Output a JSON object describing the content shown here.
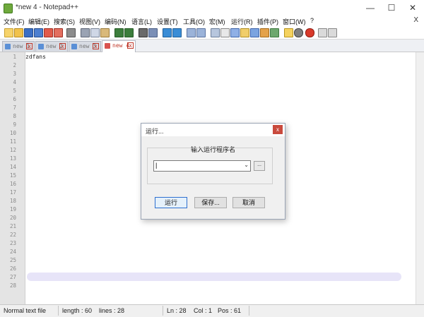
{
  "window": {
    "title": "*new 4 - Notepad++",
    "minimize_glyph": "—",
    "maximize_glyph": "☐",
    "close_glyph": "✕"
  },
  "menubar": {
    "items": [
      "文件(F)",
      "编辑(E)",
      "搜索(S)",
      "视图(V)",
      "编码(N)",
      "语言(L)",
      "设置(T)",
      "工具(O)",
      "宏(M)",
      "运行(R)",
      "插件(P)",
      "窗口(W)",
      "?"
    ],
    "close_glyph": "X"
  },
  "toolbar": {
    "icons": [
      "new-file-icon",
      "open-file-icon",
      "save-icon",
      "save-all-icon",
      "close-icon",
      "close-all-icon",
      "print-icon",
      "cut-icon",
      "copy-icon",
      "paste-icon",
      "undo-icon",
      "redo-icon",
      "find-icon",
      "replace-icon",
      "zoom-in-icon",
      "zoom-out-icon",
      "sync-v-icon",
      "sync-h-icon",
      "word-wrap-icon",
      "show-all-chars-icon",
      "indent-guide-icon",
      "doc-map-icon",
      "function-list-icon",
      "folder-as-workspace-icon",
      "monitoring-icon",
      "record-macro-icon",
      "stop-record-icon",
      "play-macro-icon",
      "run-macro-multiple-icon",
      "save-macro-icon"
    ]
  },
  "tabs": [
    {
      "label": "new 1",
      "active": false
    },
    {
      "label": "new 2",
      "active": false
    },
    {
      "label": "new 3",
      "active": false
    },
    {
      "label": "new 4",
      "active": true
    }
  ],
  "tab_close_glyph": "x",
  "editor": {
    "line_numbers": [
      "1",
      "2",
      "3",
      "4",
      "5",
      "6",
      "7",
      "8",
      "9",
      "10",
      "11",
      "12",
      "13",
      "14",
      "15",
      "16",
      "17",
      "18",
      "19",
      "20",
      "21",
      "22",
      "23",
      "24",
      "25",
      "26",
      "27",
      "28"
    ],
    "first_line_text": "zdfans"
  },
  "dialog": {
    "title": "运行...",
    "close_glyph": "x",
    "group_label": "输入运行程序名",
    "program_value": "|",
    "combo_arrow": "⌄",
    "browse_label": "...",
    "run_label": "运行",
    "save_label": "保存...",
    "cancel_label": "取消"
  },
  "statusbar": {
    "file_type": "Normal text file",
    "length": "length : 60",
    "lines": "lines : 28",
    "ln": "Ln : 28",
    "col": "Col : 1",
    "pos": "Pos : 61"
  },
  "colors": {
    "gutter": "#e4e4e4",
    "active_tab_text": "#c0392b",
    "dialog_close": "#c94a3d",
    "highlight_band": "#e4e1f7"
  }
}
